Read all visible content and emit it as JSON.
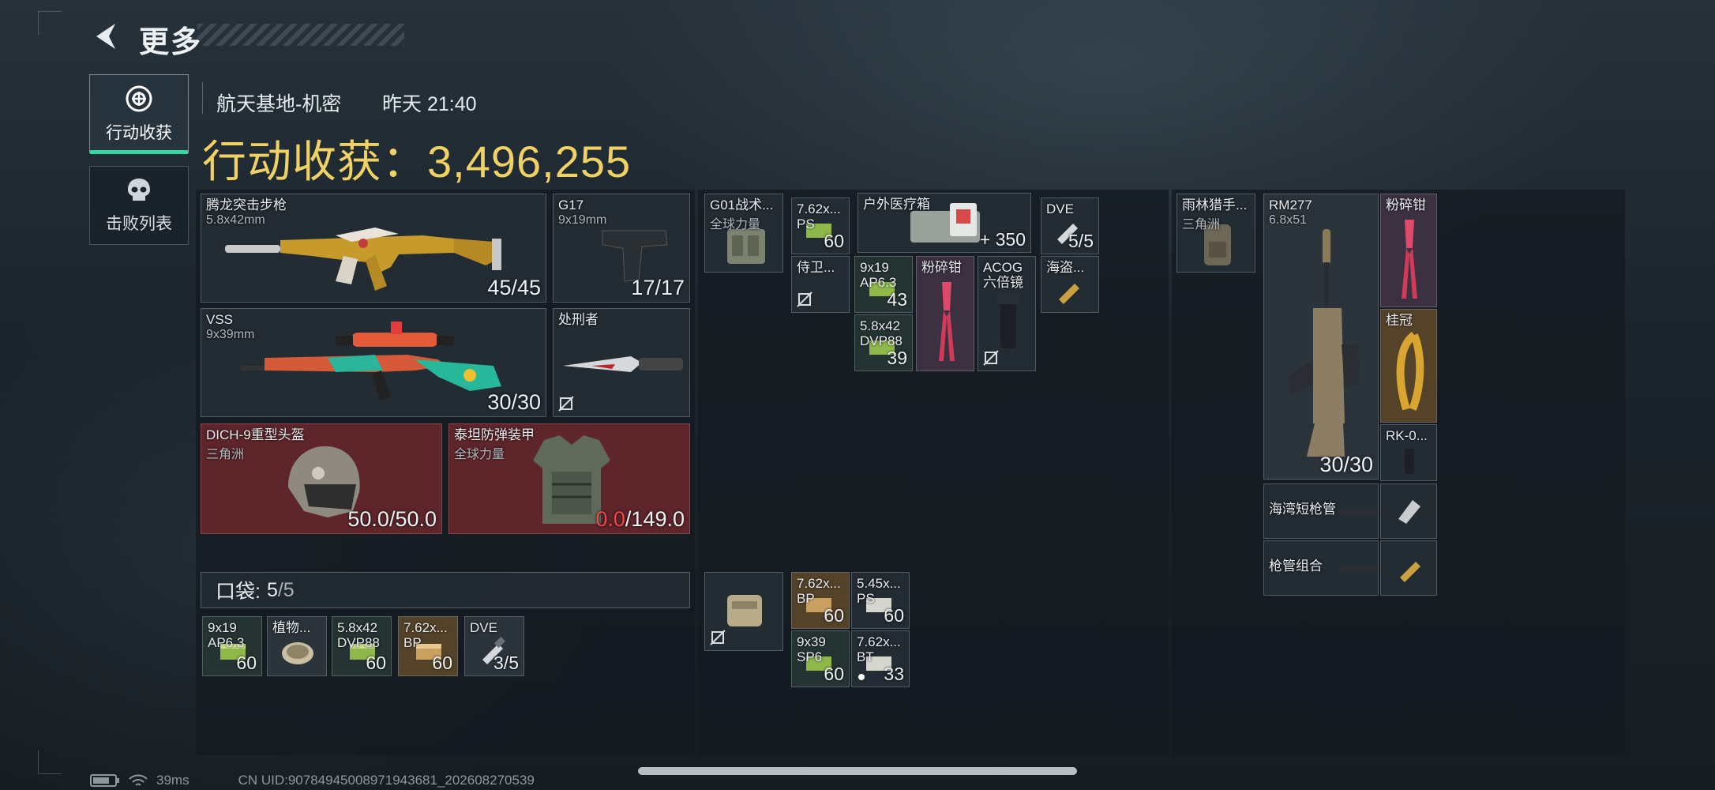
{
  "header": {
    "back_label": "back",
    "title": "更多"
  },
  "side_tabs": [
    {
      "label": "行动收获",
      "icon": "target-icon",
      "active": true
    },
    {
      "label": "击败列表",
      "icon": "skull-icon",
      "active": false
    }
  ],
  "info": {
    "map": "航天基地-机密",
    "time": "昨天 21:40"
  },
  "haul": {
    "label": "行动收获：",
    "value": "3,496,255"
  },
  "loadout": {
    "rifle": {
      "name": "腾龙突击步枪",
      "caliber": "5.8x42mm",
      "ammo": "45/45"
    },
    "pistol": {
      "name": "G17",
      "caliber": "9x19mm",
      "ammo": "17/17"
    },
    "vss": {
      "name": "VSS",
      "caliber": "9x39mm",
      "ammo": "30/30"
    },
    "melee": {
      "name": "处刑者"
    },
    "helmet": {
      "name": "DICH-9重型头盔",
      "faction": "三角洲",
      "dur": "50.0/50.0"
    },
    "armor": {
      "name": "泰坦防弹装甲",
      "faction": "全球力量",
      "dur_cur": "0.0",
      "dur_max": "/149.0"
    }
  },
  "pocket": {
    "label": "口袋:",
    "count": "5",
    "max": "/5",
    "items": [
      {
        "name": "9x19\nAP6.3",
        "count": "60"
      },
      {
        "name": "植物...",
        "count": ""
      },
      {
        "name": "5.8x42\nDVP88",
        "count": "60"
      },
      {
        "name": "7.62x...\nBP",
        "count": "60"
      },
      {
        "name": "DVE",
        "count": "3/5"
      }
    ]
  },
  "rig": {
    "vest": {
      "name": "G01战术...",
      "faction": "全球力量"
    },
    "items": [
      {
        "name": "7.62x...\nPS",
        "count": "60"
      },
      {
        "name": "户外医疗箱",
        "count": "+ 350"
      },
      {
        "name": "DVE",
        "count": "5/5"
      },
      {
        "name": "侍卫...",
        "count": ""
      },
      {
        "name": "9x19\nAP6.3",
        "count": "43"
      },
      {
        "name": "5.8x42\nDVP88",
        "count": "39"
      },
      {
        "name": "粉碎钳",
        "count": ""
      },
      {
        "name": "ACOG\n六倍镜",
        "count": ""
      },
      {
        "name": "海盗...",
        "count": ""
      }
    ]
  },
  "pouch": {
    "items": [
      {
        "name": "7.62x...\nBP",
        "count": "60"
      },
      {
        "name": "5.45x...\nPS",
        "count": "60"
      },
      {
        "name": "9x39\nSP6",
        "count": "60"
      },
      {
        "name": "7.62x...\nBT",
        "count": "33"
      }
    ]
  },
  "backpack": {
    "bag": {
      "name": "雨林猎手...",
      "faction": "三角洲"
    },
    "rm277": {
      "name": "RM277",
      "caliber": "6.8x51",
      "ammo": "30/30"
    },
    "items": [
      {
        "name": "粉碎钳"
      },
      {
        "name": "桂冠"
      },
      {
        "name": "RK-0..."
      },
      {
        "name": "海湾短枪管"
      },
      {
        "name": "枪管组合"
      }
    ]
  },
  "footer": {
    "ping": "39ms",
    "uid": "CN UID:90784945008971943681_202608270539"
  }
}
